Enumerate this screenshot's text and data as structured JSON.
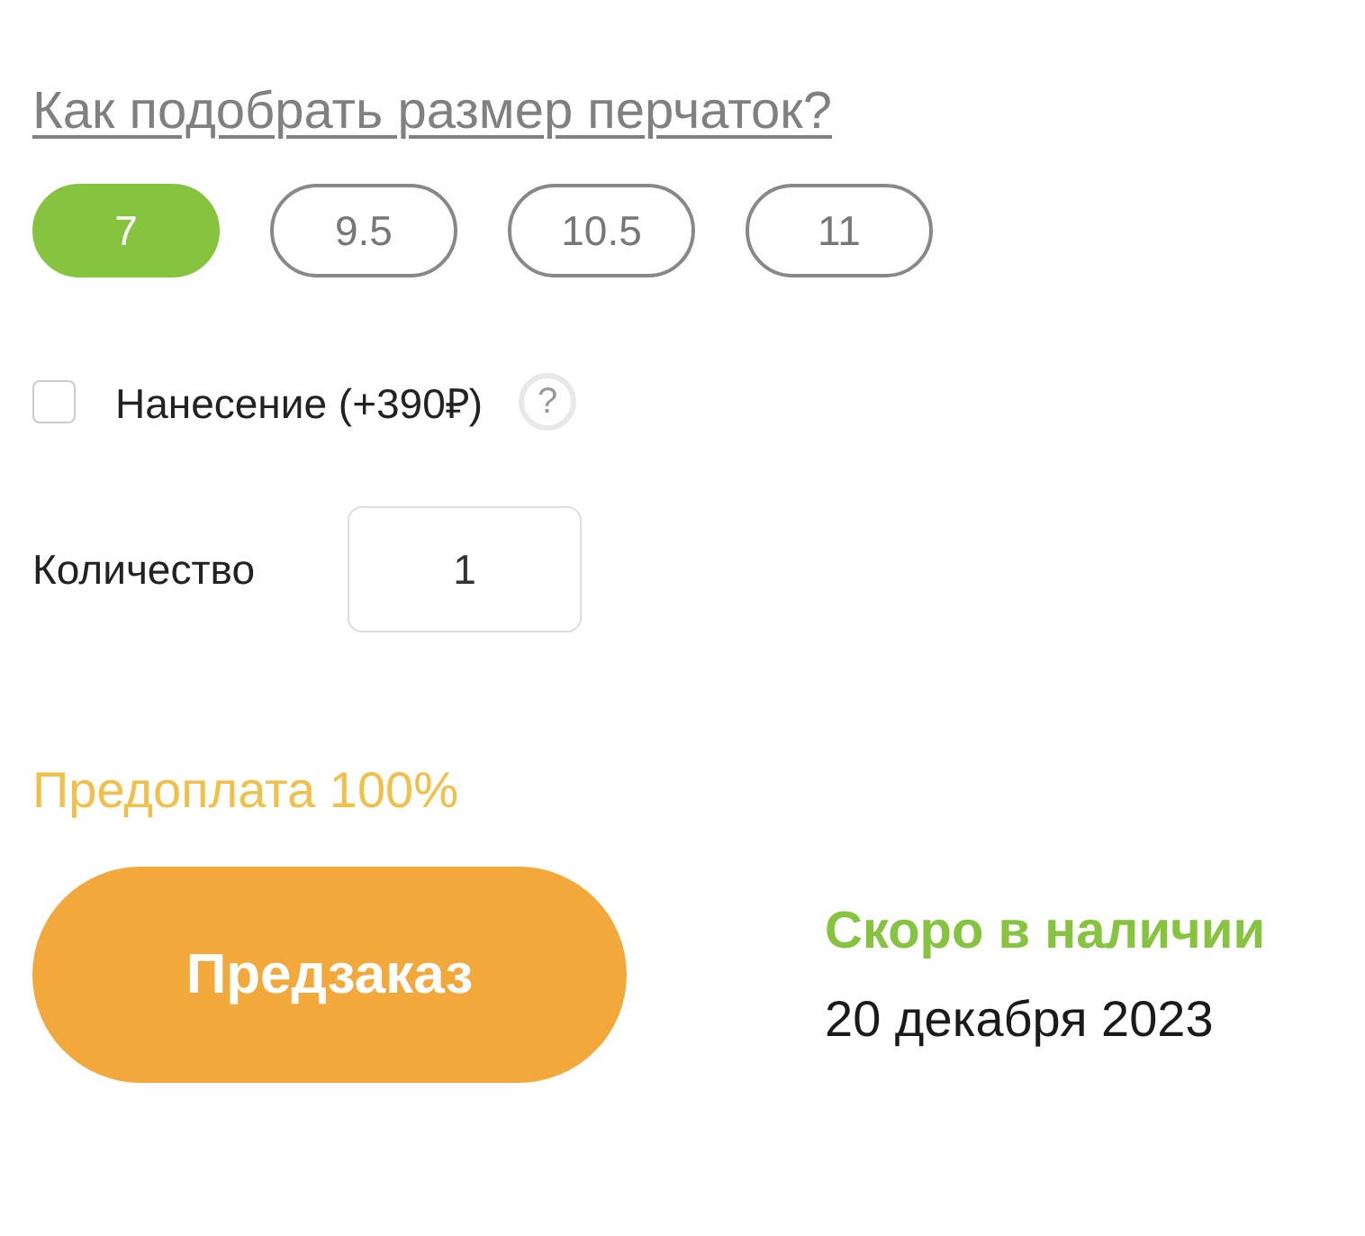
{
  "size_guide_link": "Как подобрать размер перчаток?",
  "sizes": [
    {
      "label": "7",
      "selected": true
    },
    {
      "label": "9.5",
      "selected": false
    },
    {
      "label": "10.5",
      "selected": false
    },
    {
      "label": "11",
      "selected": false
    }
  ],
  "printing": {
    "label": "Нанесение (+390₽)",
    "checked": false,
    "help": "?"
  },
  "quantity": {
    "label": "Количество",
    "value": "1"
  },
  "prepayment": "Предоплата 100%",
  "preorder_button": "Предзаказ",
  "availability": {
    "status": "Скоро в наличии",
    "date": "20 декабря 2023"
  }
}
